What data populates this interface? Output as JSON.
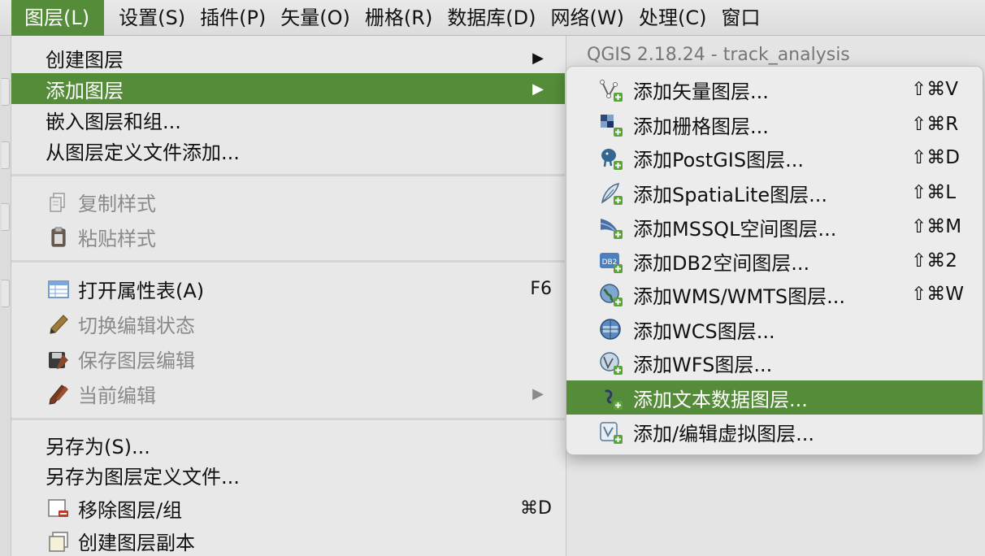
{
  "menubar": {
    "items": [
      {
        "label": "图层(L)",
        "active": true
      },
      {
        "label": "设置(S)"
      },
      {
        "label": "插件(P)"
      },
      {
        "label": "矢量(O)"
      },
      {
        "label": "栅格(R)"
      },
      {
        "label": "数据库(D)"
      },
      {
        "label": "网络(W)"
      },
      {
        "label": "处理(C)"
      },
      {
        "label": "窗口"
      }
    ]
  },
  "window": {
    "title": "QGIS 2.18.24 - track_analysis"
  },
  "layer_menu": {
    "create_layer": {
      "label": "创建图层",
      "arrow": "▶"
    },
    "add_layer": {
      "label": "添加图层",
      "arrow": "▶"
    },
    "embed_layers": {
      "label": "嵌入图层和组..."
    },
    "add_from_definition": {
      "label": "从图层定义文件添加..."
    },
    "copy_style": {
      "label": "复制样式",
      "icon": "copy-style-icon"
    },
    "paste_style": {
      "label": "粘贴样式",
      "icon": "paste-style-icon"
    },
    "open_attribute_table": {
      "label": "打开属性表(A)",
      "shortcut": "F6",
      "icon": "attribute-table-icon"
    },
    "toggle_editing": {
      "label": "切换编辑状态",
      "icon": "pencil-icon"
    },
    "save_layer_edits": {
      "label": "保存图层编辑",
      "icon": "save-edits-icon"
    },
    "current_edits": {
      "label": "当前编辑",
      "arrow": "▶",
      "icon": "edits-icon"
    },
    "save_as": {
      "label": "另存为(S)..."
    },
    "save_as_definition": {
      "label": "另存为图层定义文件..."
    },
    "remove_layer": {
      "label": "移除图层/组",
      "shortcut": "⌘D",
      "icon": "remove-layer-icon"
    },
    "duplicate_layer": {
      "label": "创建图层副本",
      "icon": "duplicate-layer-icon"
    }
  },
  "submenu": {
    "items": [
      {
        "label": "添加矢量图层...",
        "shortcut": "⇧⌘V",
        "icon": "vector-layer-icon"
      },
      {
        "label": "添加栅格图层...",
        "shortcut": "⇧⌘R",
        "icon": "raster-layer-icon"
      },
      {
        "label": "添加PostGIS图层...",
        "shortcut": "⇧⌘D",
        "icon": "postgis-icon"
      },
      {
        "label": "添加SpatiaLite图层...",
        "shortcut": "⇧⌘L",
        "icon": "spatialite-icon"
      },
      {
        "label": "添加MSSQL空间图层...",
        "shortcut": "⇧⌘M",
        "icon": "mssql-icon"
      },
      {
        "label": "添加DB2空间图层...",
        "shortcut": "⇧⌘2",
        "icon": "db2-icon"
      },
      {
        "label": "添加WMS/WMTS图层...",
        "shortcut": "⇧⌘W",
        "icon": "wms-icon"
      },
      {
        "label": "添加WCS图层...",
        "icon": "wcs-icon"
      },
      {
        "label": "添加WFS图层...",
        "icon": "wfs-icon"
      },
      {
        "label": "添加文本数据图层...",
        "icon": "delimited-text-icon",
        "highlighted": true
      },
      {
        "label": "添加/编辑虚拟图层...",
        "icon": "virtual-layer-icon"
      }
    ]
  },
  "colors": {
    "highlight": "#558c39",
    "menu_bg": "#e8e8e8",
    "disabled_text": "#8a8a8a"
  }
}
